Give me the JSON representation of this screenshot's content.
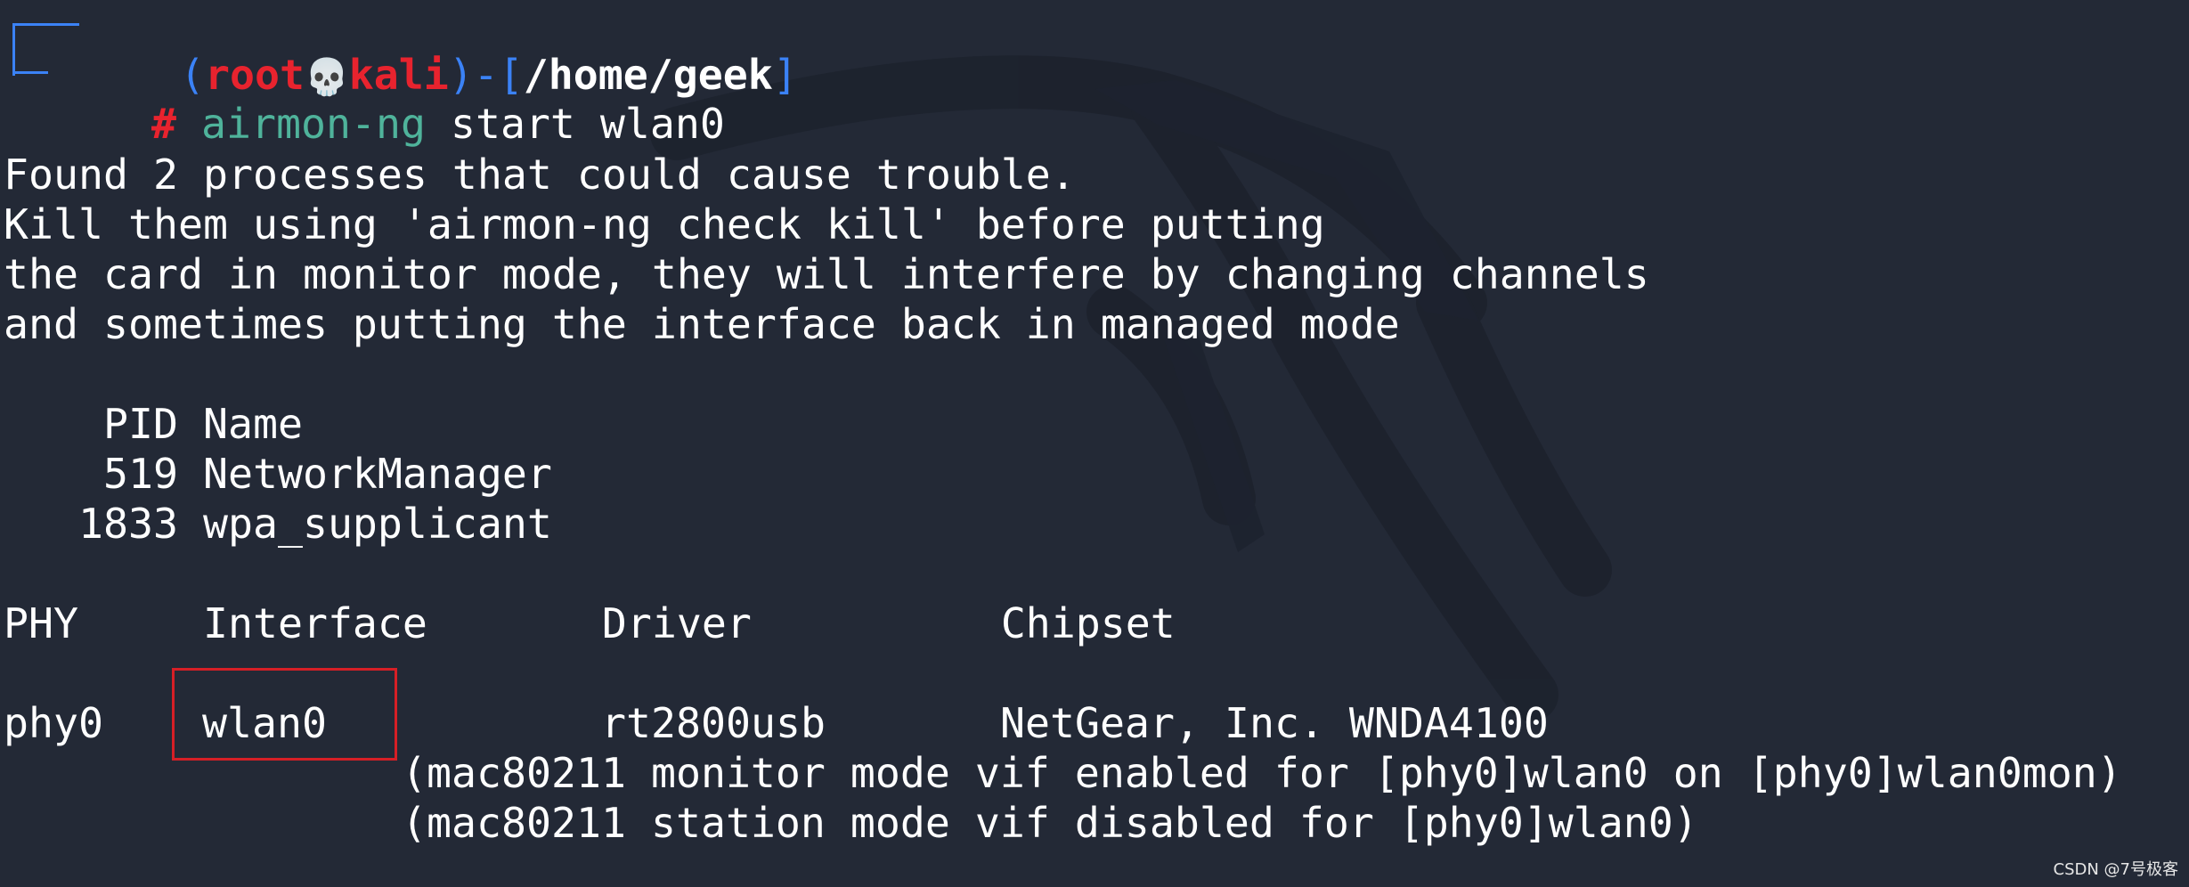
{
  "prompt": {
    "open_paren": "(",
    "user": "root",
    "skull": "💀",
    "host": "kali",
    "close_dash": ")-[",
    "cwd": "/home/geek",
    "close_bracket": "]",
    "hash": "#",
    "command": "airmon-ng",
    "args": " start wlan0"
  },
  "output": {
    "warning_lines": [
      "Found 2 processes that could cause trouble.",
      "Kill them using 'airmon-ng check kill' before putting",
      "the card in monitor mode, they will interfere by changing channels",
      "and sometimes putting the interface back in managed mode"
    ],
    "process_header": "    PID Name",
    "processes": [
      "    519 NetworkManager",
      "   1833 wpa_supplicant"
    ],
    "iface_header": "PHY     Interface       Driver          Chipset",
    "iface_row": {
      "phy": "phy0",
      "interface": "wlan0",
      "driver": "rt2800usb",
      "chipset": "NetGear, Inc. WNDA4100"
    },
    "notes": [
      "(mac80211 monitor mode vif enabled for [phy0]wlan0 on [phy0]wlan0mon)",
      "(mac80211 station mode vif disabled for [phy0]wlan0)"
    ]
  },
  "watermark": "CSDN @7号极客",
  "colors": {
    "background": "#232936",
    "prompt_frame": "#3b82f6",
    "root_user": "#e8232e",
    "command": "#4fb39b",
    "highlight_box": "#d61f26"
  }
}
